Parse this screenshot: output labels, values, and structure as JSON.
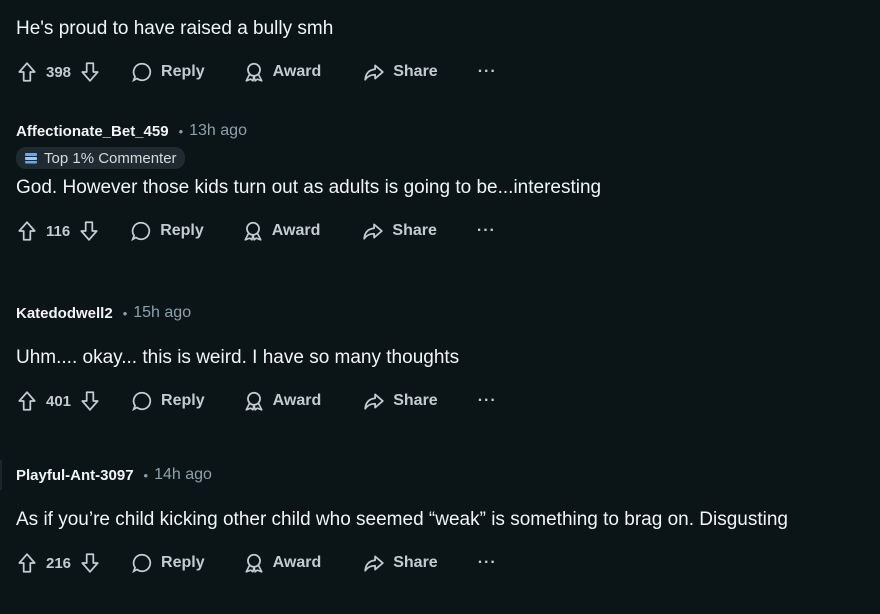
{
  "comments": [
    {
      "author": "",
      "time": "",
      "body": "He's proud to have raised a bully smh",
      "votes": "398"
    },
    {
      "author": "Affectionate_Bet_459",
      "time": "13h ago",
      "badge": "Top 1% Commenter",
      "body": "God. However those kids turn out as adults is going to be...interesting",
      "votes": "116"
    },
    {
      "author": "Katedodwell2",
      "time": "15h ago",
      "body": "Uhm.... okay... this is weird. I have so many thoughts",
      "votes": "401"
    },
    {
      "author": "Playful-Ant-3097",
      "time": "14h ago",
      "body": "As if you’re child kicking other child who seemed “weak” is something to brag on. Disgusting",
      "votes": "216"
    }
  ],
  "actions": {
    "reply": "Reply",
    "award": "Award",
    "share": "Share",
    "more": "···"
  },
  "separator": "•",
  "icons": [
    "upvote-icon",
    "downvote-icon",
    "comment-bubble-icon",
    "award-icon",
    "share-icon",
    "badge-icon"
  ]
}
